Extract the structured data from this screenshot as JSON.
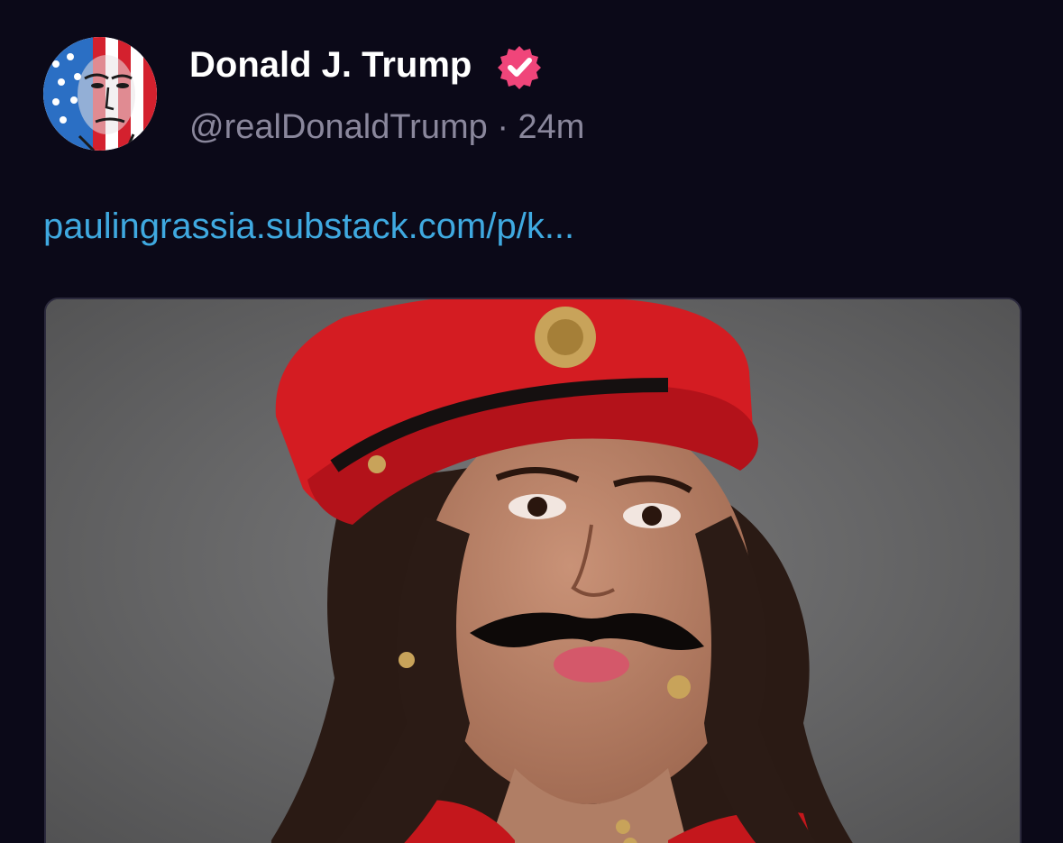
{
  "post": {
    "author": {
      "display_name": "Donald J. Trump",
      "verified": true,
      "verified_icon": "verified-check-badge-icon",
      "handle": "@realDonaldTrump",
      "separator": "·",
      "timestamp": "24m"
    },
    "link_text": "paulingrassia.substack.com/p/k...",
    "media": {
      "kind": "image"
    }
  },
  "colors": {
    "background": "#0b0918",
    "name_text": "#ffffff",
    "meta_text": "#8a879c",
    "link": "#3fa9e0",
    "badge": "#f0457a",
    "card_border": "#2c2a3d"
  }
}
